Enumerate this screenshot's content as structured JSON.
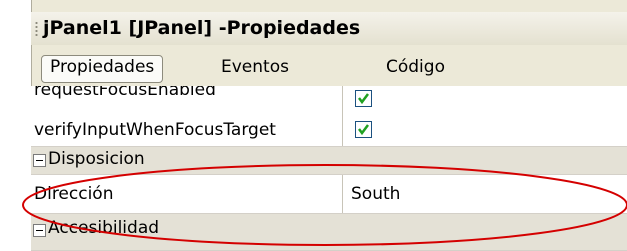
{
  "panel": {
    "title": "jPanel1 [JPanel] -Propiedades"
  },
  "tabs": [
    {
      "label": "Propiedades",
      "active": true
    },
    {
      "label": "Eventos",
      "active": false
    },
    {
      "label": "Código",
      "active": false
    }
  ],
  "properties": {
    "row1": {
      "name": "requestFocusEnabled",
      "checked": true
    },
    "row2": {
      "name": "verifyInputWhenFocusTarget",
      "checked": true
    },
    "category1": {
      "label": "Disposicion",
      "expanded": true
    },
    "row3": {
      "name": "Dirección",
      "value": "South"
    },
    "category2": {
      "label": "Accesibilidad",
      "expanded": true
    }
  },
  "colors": {
    "highlight_ellipse": "#d40000",
    "checkmark": "#21a121",
    "category_bg": "#e4e1d6"
  }
}
